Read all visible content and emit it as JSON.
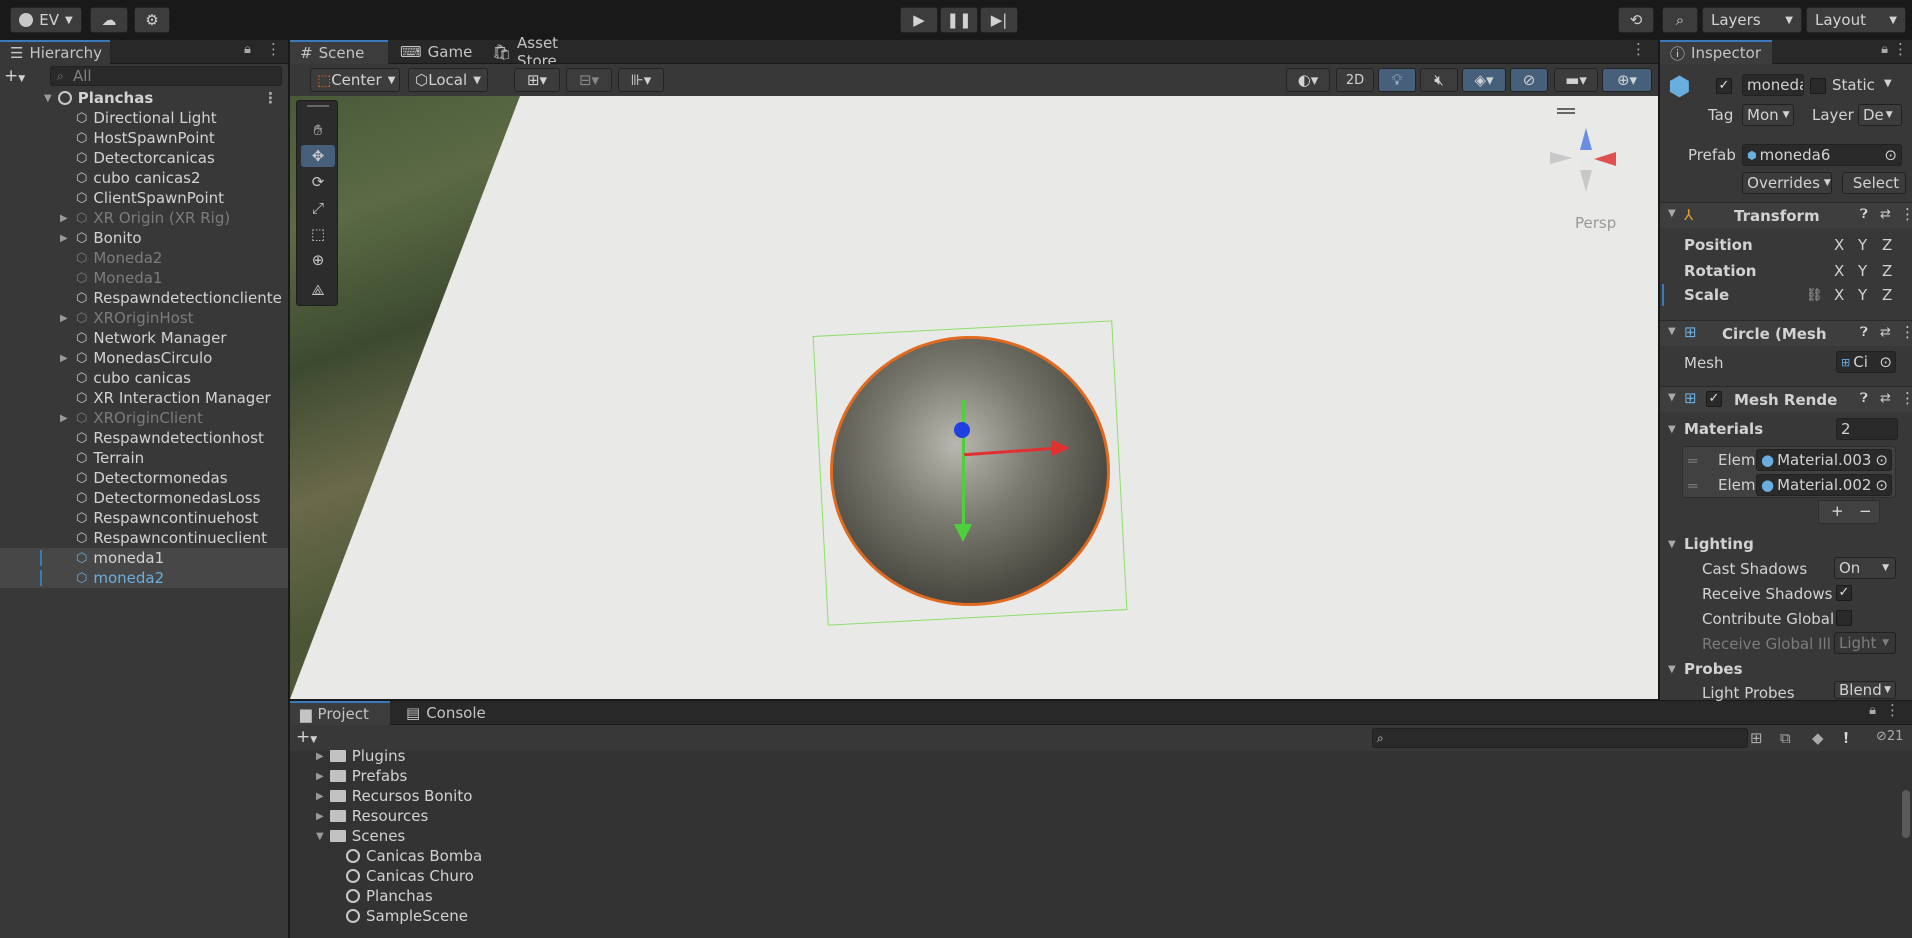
{
  "top_toolbar": {
    "account_label": "EV",
    "layers_label": "Layers",
    "layout_label": "Layout"
  },
  "hierarchy": {
    "tab_label": "Hierarchy",
    "search_placeholder": "All",
    "scene_name": "Planchas",
    "items": [
      {
        "label": "Directional Light",
        "dim": false,
        "expandable": false
      },
      {
        "label": "HostSpawnPoint",
        "dim": false,
        "expandable": false
      },
      {
        "label": "Detectorcanicas",
        "dim": false,
        "expandable": false
      },
      {
        "label": "cubo canicas2",
        "dim": false,
        "expandable": false
      },
      {
        "label": "ClientSpawnPoint",
        "dim": false,
        "expandable": false
      },
      {
        "label": "XR Origin (XR Rig)",
        "dim": true,
        "expandable": true
      },
      {
        "label": "Bonito",
        "dim": false,
        "expandable": true
      },
      {
        "label": "Moneda2",
        "dim": true,
        "expandable": false
      },
      {
        "label": "Moneda1",
        "dim": true,
        "expandable": false
      },
      {
        "label": "Respawndetectioncliente",
        "dim": false,
        "expandable": false
      },
      {
        "label": "XROriginHost",
        "dim": true,
        "expandable": true
      },
      {
        "label": "Network Manager",
        "dim": false,
        "expandable": false
      },
      {
        "label": "MonedasCirculo",
        "dim": false,
        "expandable": true
      },
      {
        "label": "cubo canicas",
        "dim": false,
        "expandable": false
      },
      {
        "label": "XR Interaction Manager",
        "dim": false,
        "expandable": false
      },
      {
        "label": "XROriginClient",
        "dim": true,
        "expandable": true
      },
      {
        "label": "Respawndetectionhost",
        "dim": false,
        "expandable": false
      },
      {
        "label": "Terrain",
        "dim": false,
        "expandable": false
      },
      {
        "label": "Detectormonedas",
        "dim": false,
        "expandable": false
      },
      {
        "label": "DetectormonedasLoss",
        "dim": false,
        "expandable": false
      },
      {
        "label": "Respawncontinuehost",
        "dim": false,
        "expandable": false
      },
      {
        "label": "Respawncontinueclient",
        "dim": false,
        "expandable": false
      },
      {
        "label": "moneda1",
        "dim": false,
        "expandable": false
      },
      {
        "label": "moneda2",
        "dim": false,
        "expandable": false
      }
    ]
  },
  "scene": {
    "tabs": [
      "Scene",
      "Game",
      "Asset Store"
    ],
    "pivot_label": "Center",
    "space_label": "Local",
    "mode_2d": "2D",
    "persp_label": "Persp"
  },
  "inspector": {
    "tab_label": "Inspector",
    "object_name": "moneda",
    "static_label": "Static",
    "tag_label": "Tag",
    "tag_value": "Mon",
    "layer_label": "Layer",
    "layer_value": "De",
    "prefab_label": "Prefab",
    "prefab_value": "moneda6",
    "overrides_label": "Overrides",
    "select_label": "Select",
    "transform_title": "Transform",
    "position_label": "Position",
    "rotation_label": "Rotation",
    "scale_label": "Scale",
    "x": "X",
    "y": "Y",
    "z": "Z",
    "mesh_filter_title": "Circle (Mesh",
    "mesh_label": "Mesh",
    "mesh_value": "Ci",
    "mesh_renderer_title": "Mesh Rende",
    "materials_label": "Materials",
    "materials_count": "2",
    "element_label": "Elem",
    "material_1": "Material.003",
    "material_2": "Material.002",
    "lighting_label": "Lighting",
    "cast_shadows_label": "Cast Shadows",
    "cast_shadows_value": "On",
    "receive_shadows_label": "Receive Shadows",
    "contribute_global_label": "Contribute Global",
    "receive_global_label": "Receive Global Illu",
    "receive_global_value": "Light",
    "probes_label": "Probes",
    "light_probes_label": "Light Probes",
    "light_probes_value": "Blend"
  },
  "project": {
    "tabs": [
      "Project",
      "Console"
    ],
    "hidden_count": "21",
    "items": [
      {
        "label": "Plugins",
        "type": "folder",
        "indent": 0,
        "expanded": false
      },
      {
        "label": "Prefabs",
        "type": "folder",
        "indent": 0,
        "expanded": false
      },
      {
        "label": "Recursos Bonito",
        "type": "folder",
        "indent": 0,
        "expanded": false
      },
      {
        "label": "Resources",
        "type": "folder",
        "indent": 0,
        "expanded": false
      },
      {
        "label": "Scenes",
        "type": "folder",
        "indent": 0,
        "expanded": true
      },
      {
        "label": "Canicas Bomba",
        "type": "scene",
        "indent": 1,
        "expanded": false
      },
      {
        "label": "Canicas Churo",
        "type": "scene",
        "indent": 1,
        "expanded": false
      },
      {
        "label": "Planchas",
        "type": "scene",
        "indent": 1,
        "expanded": false
      },
      {
        "label": "SampleScene",
        "type": "scene",
        "indent": 1,
        "expanded": false
      }
    ]
  },
  "colors": {
    "accent": "#3a79bb",
    "selection": "#474747",
    "coin_outline": "#e06a20"
  }
}
